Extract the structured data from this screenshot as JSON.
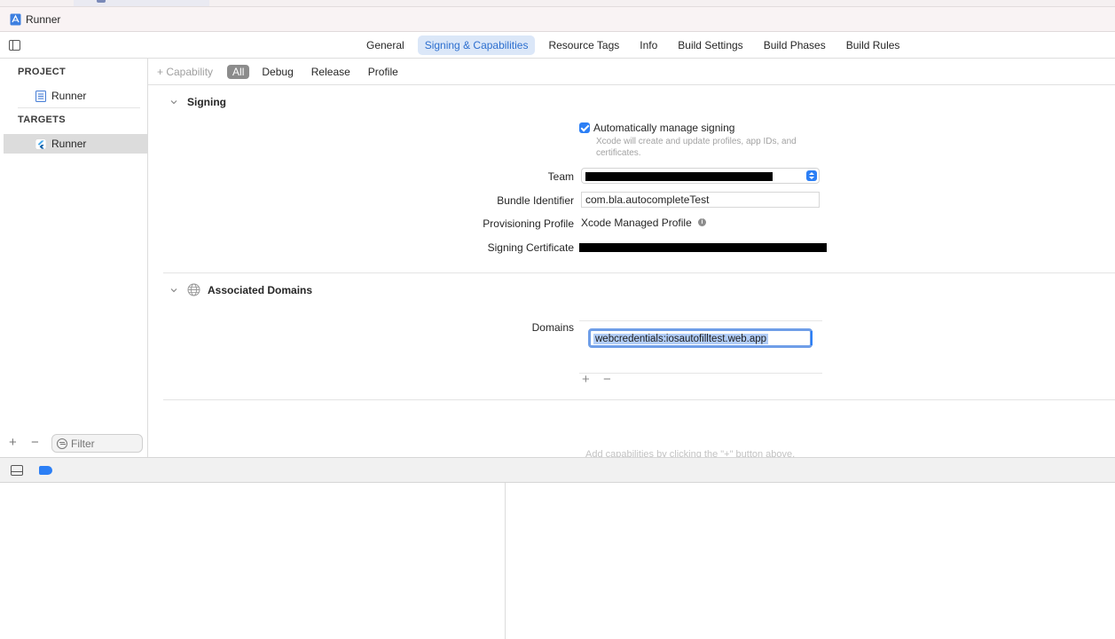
{
  "breadcrumb": {
    "project_name": "Runner"
  },
  "tabs": [
    {
      "label": "General",
      "active": false
    },
    {
      "label": "Signing & Capabilities",
      "active": true
    },
    {
      "label": "Resource Tags",
      "active": false
    },
    {
      "label": "Info",
      "active": false
    },
    {
      "label": "Build Settings",
      "active": false
    },
    {
      "label": "Build Phases",
      "active": false
    },
    {
      "label": "Build Rules",
      "active": false
    }
  ],
  "sidebar": {
    "project_header": "PROJECT",
    "project_item": "Runner",
    "targets_header": "TARGETS",
    "target_item": "Runner",
    "filter_placeholder": "Filter",
    "add_symbol": "+",
    "remove_symbol": "−"
  },
  "filterbar": {
    "capability_label": "+ Capability",
    "segments": [
      "All",
      "Debug",
      "Release",
      "Profile"
    ],
    "active_segment": "All"
  },
  "signing": {
    "title": "Signing",
    "auto_manage_label": "Automatically manage signing",
    "auto_manage_checked": true,
    "auto_manage_help": "Xcode will create and update profiles, app IDs, and certificates.",
    "team_label": "Team",
    "bundle_label": "Bundle Identifier",
    "bundle_value": "com.bla.autocompleteTest",
    "provisioning_label": "Provisioning Profile",
    "provisioning_value": "Xcode Managed Profile",
    "info_symbol": "i",
    "certificate_label": "Signing Certificate"
  },
  "associated_domains": {
    "title": "Associated Domains",
    "domains_label": "Domains",
    "domain_value": "webcredentials:iosautofilltest.web.app",
    "add_symbol": "+",
    "remove_symbol": "−"
  },
  "hint_text": "Add capabilities by clicking the \"+\" button above.",
  "colors": {
    "accent": "#2c7ff5",
    "tab_active_bg": "#dbe7f8",
    "selection": "#b2cdf7"
  }
}
